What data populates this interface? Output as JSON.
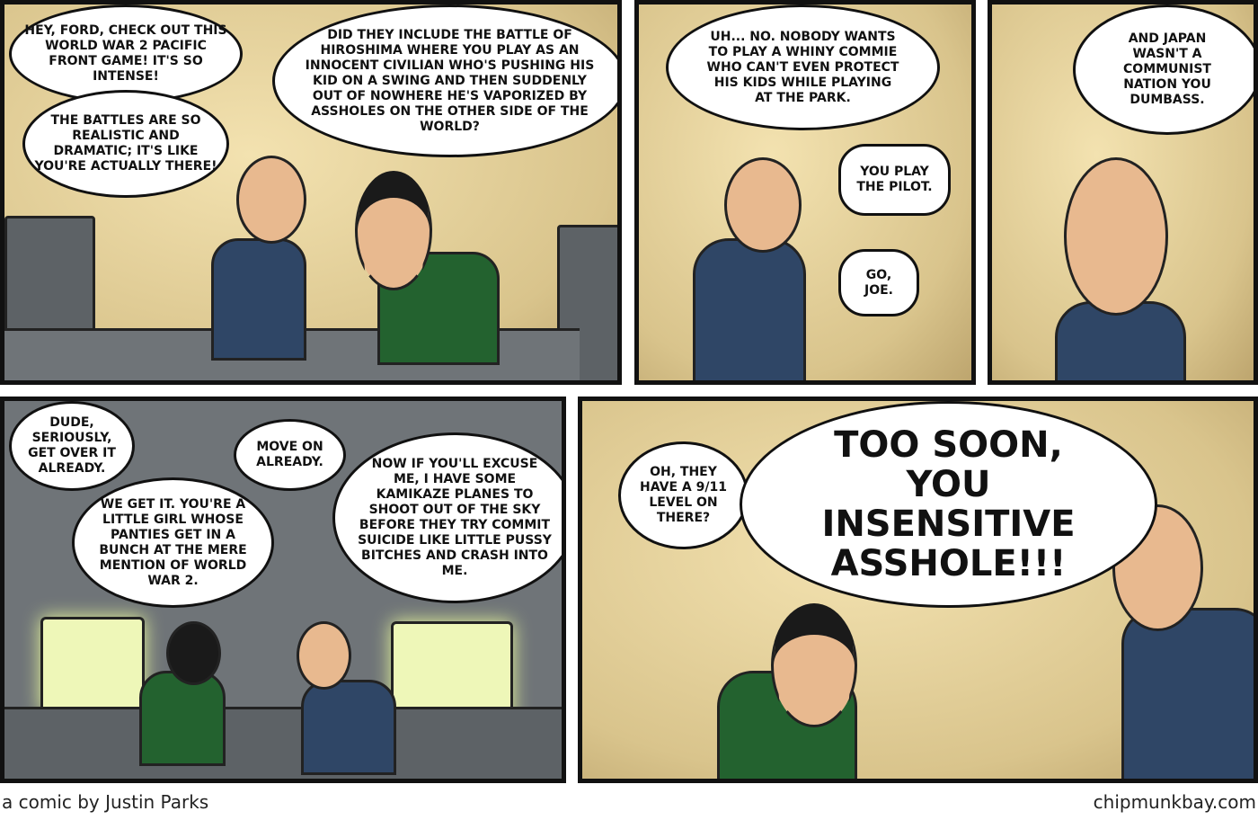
{
  "panels": [
    {
      "bubbles": [
        "HEY, FORD, CHECK OUT THIS WORLD WAR 2 PACIFIC FRONT GAME! IT'S SO INTENSE!",
        "THE BATTLES ARE SO REALISTIC AND DRAMATIC; IT'S LIKE YOU'RE ACTUALLY THERE!",
        "DID THEY INCLUDE THE BATTLE OF HIROSHIMA WHERE YOU PLAY AS AN INNOCENT CIVILIAN WHO'S PUSHING HIS KID ON A SWING AND THEN SUDDENLY OUT OF NOWHERE HE'S VAPORIZED BY ASSHOLES ON THE OTHER SIDE OF THE WORLD?"
      ]
    },
    {
      "bubbles": [
        "UH... NO. NOBODY WANTS TO PLAY A WHINY COMMIE WHO CAN'T EVEN PROTECT HIS KIDS WHILE PLAYING AT THE PARK.",
        "YOU PLAY THE PILOT.",
        "GO, JOE."
      ]
    },
    {
      "bubbles": [
        "AND JAPAN WASN'T A COMMUNIST NATION YOU DUMBASS."
      ]
    },
    {
      "bubbles": [
        "DUDE, SERIOUSLY, GET OVER IT ALREADY.",
        "WE GET IT. YOU'RE A LITTLE GIRL WHOSE PANTIES GET IN A BUNCH AT THE MERE MENTION OF WORLD WAR 2.",
        "MOVE ON ALREADY.",
        "NOW IF YOU'LL EXCUSE ME, I HAVE SOME KAMIKAZE PLANES TO SHOOT OUT OF THE SKY BEFORE THEY TRY COMMIT SUICIDE LIKE LITTLE PUSSY BITCHES AND CRASH INTO ME."
      ]
    },
    {
      "bubbles": [
        "OH, THEY HAVE A 9/11 LEVEL ON THERE?",
        "TOO SOON, YOU INSENSITIVE ASSHOLE!!!"
      ]
    }
  ],
  "footer": {
    "credit": "a comic by Justin Parks",
    "site": "chipmunkbay.com"
  }
}
